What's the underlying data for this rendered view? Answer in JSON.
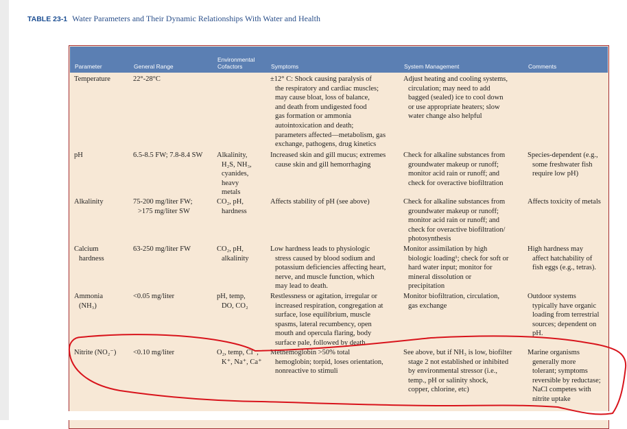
{
  "caption": {
    "number": "TABLE 23-1",
    "title": "Water Parameters and Their Dynamic Relationships With Water and Health"
  },
  "colors": {
    "header": "#5b7fb3",
    "body": "#f7e8d6",
    "frame": "#a32c30",
    "annotation": "#d8131b"
  },
  "table": {
    "columns": [
      "Parameter",
      "General Range",
      "Environmental Cofactors",
      "System Management",
      "Comments"
    ],
    "symptoms_header": "Symptoms",
    "rows": [
      {
        "parameter": [
          "Temperature"
        ],
        "range": [
          "22°-28°C"
        ],
        "cofactors": [],
        "symptoms": [
          "±12° C: Shock causing paralysis of",
          "the respiratory and cardiac muscles;",
          "may cause bloat, loss of balance,",
          "and death from undigested food",
          "gas formation or ammonia",
          "autointoxication and death;",
          "parameters affected—metabolism, gas",
          "exchange, pathogens, drug kinetics"
        ],
        "management": [
          "Adjust heating and cooling systems,",
          "circulation; may need to add",
          "bagged (sealed) ice to cool down",
          "or use appropriate heaters; slow",
          "water change also helpful"
        ],
        "comments": []
      },
      {
        "parameter": [
          "pH"
        ],
        "range": [
          "6.5-8.5 FW; 7.8-8.4 SW"
        ],
        "cofactors": [
          "Alkalinity,",
          "H₂S, NH₃,",
          "cyanides,",
          "heavy",
          "metals"
        ],
        "symptoms": [
          "Increased skin and gill mucus; extremes",
          "cause skin and gill hemorrhaging"
        ],
        "management": [
          "Check for alkaline substances from",
          "groundwater makeup or runoff;",
          "monitor acid rain or runoff; and",
          "check for overactive biofiltration"
        ],
        "comments": [
          "Species-dependent (e.g.,",
          "some freshwater fish",
          "require low pH)"
        ]
      },
      {
        "parameter": [
          "Alkalinity"
        ],
        "range": [
          "75-200 mg/liter FW;",
          ">175 mg/liter SW"
        ],
        "cofactors": [
          "CO₂, pH,",
          "hardness"
        ],
        "symptoms": [
          "Affects stability of pH (see above)"
        ],
        "management": [
          "Check for alkaline substances from",
          "groundwater makeup or runoff;",
          "monitor acid rain or runoff; and",
          "check for overactive biofiltration/",
          "photosynthesis"
        ],
        "comments": [
          "Affects toxicity of metals"
        ]
      },
      {
        "parameter": [
          "Calcium",
          "hardness"
        ],
        "range": [
          "63-250 mg/liter FW"
        ],
        "cofactors": [
          "CO₂, pH,",
          "alkalinity"
        ],
        "symptoms": [
          "Low hardness leads to physiologic",
          "stress caused by blood sodium and",
          "potassium deficiencies affecting heart,",
          "nerve, and muscle function, which",
          "may lead to death."
        ],
        "management": [
          "Monitor assimilation by high",
          "biologic loading¹; check for soft or",
          "hard water input; monitor for",
          "mineral dissolution or",
          "precipitation"
        ],
        "comments": [
          "High hardness may",
          "affect hatchability of",
          "fish eggs (e.g., tetras)."
        ]
      },
      {
        "parameter": [
          "Ammonia",
          "(NH₃)"
        ],
        "range": [
          "<0.05 mg/liter"
        ],
        "cofactors": [
          "pH, temp,",
          "DO, CO₂"
        ],
        "symptoms": [
          "Restlessness or agitation, irregular or",
          "increased respiration, congregation at",
          "surface, lose equilibrium, muscle",
          "spasms, lateral recumbency, open",
          "mouth and opercula flaring, body",
          "surface pale, followed by death"
        ],
        "management": [
          "Monitor biofiltration, circulation,",
          "gas exchange"
        ],
        "comments": [
          "Outdoor systems",
          "typically have organic",
          "loading from terrestrial",
          "sources; dependent on",
          "pH."
        ]
      },
      {
        "parameter": [
          "Nitrite (NO₂⁻)"
        ],
        "range": [
          "<0.10 mg/liter"
        ],
        "cofactors": [
          "O₂, temp, Cl⁻,",
          "K⁺, Na⁺, Ca⁺"
        ],
        "symptoms": [
          "Methemoglobin >50% total",
          "hemoglobin; torpid, loses orientation,",
          "nonreactive to stimuli"
        ],
        "management": [
          "See above, but if NH₃ is low, biofilter",
          "stage 2 not established or inhibited",
          "by environmental stressor (i.e.,",
          "temp., pH or salinity shock,",
          "copper, chlorine, etc)"
        ],
        "comments": [
          "Marine organisms",
          "generally more",
          "tolerant; symptoms",
          "reversible by reductase;",
          "NaCl competes with",
          "nitrite uptake"
        ]
      }
    ]
  }
}
